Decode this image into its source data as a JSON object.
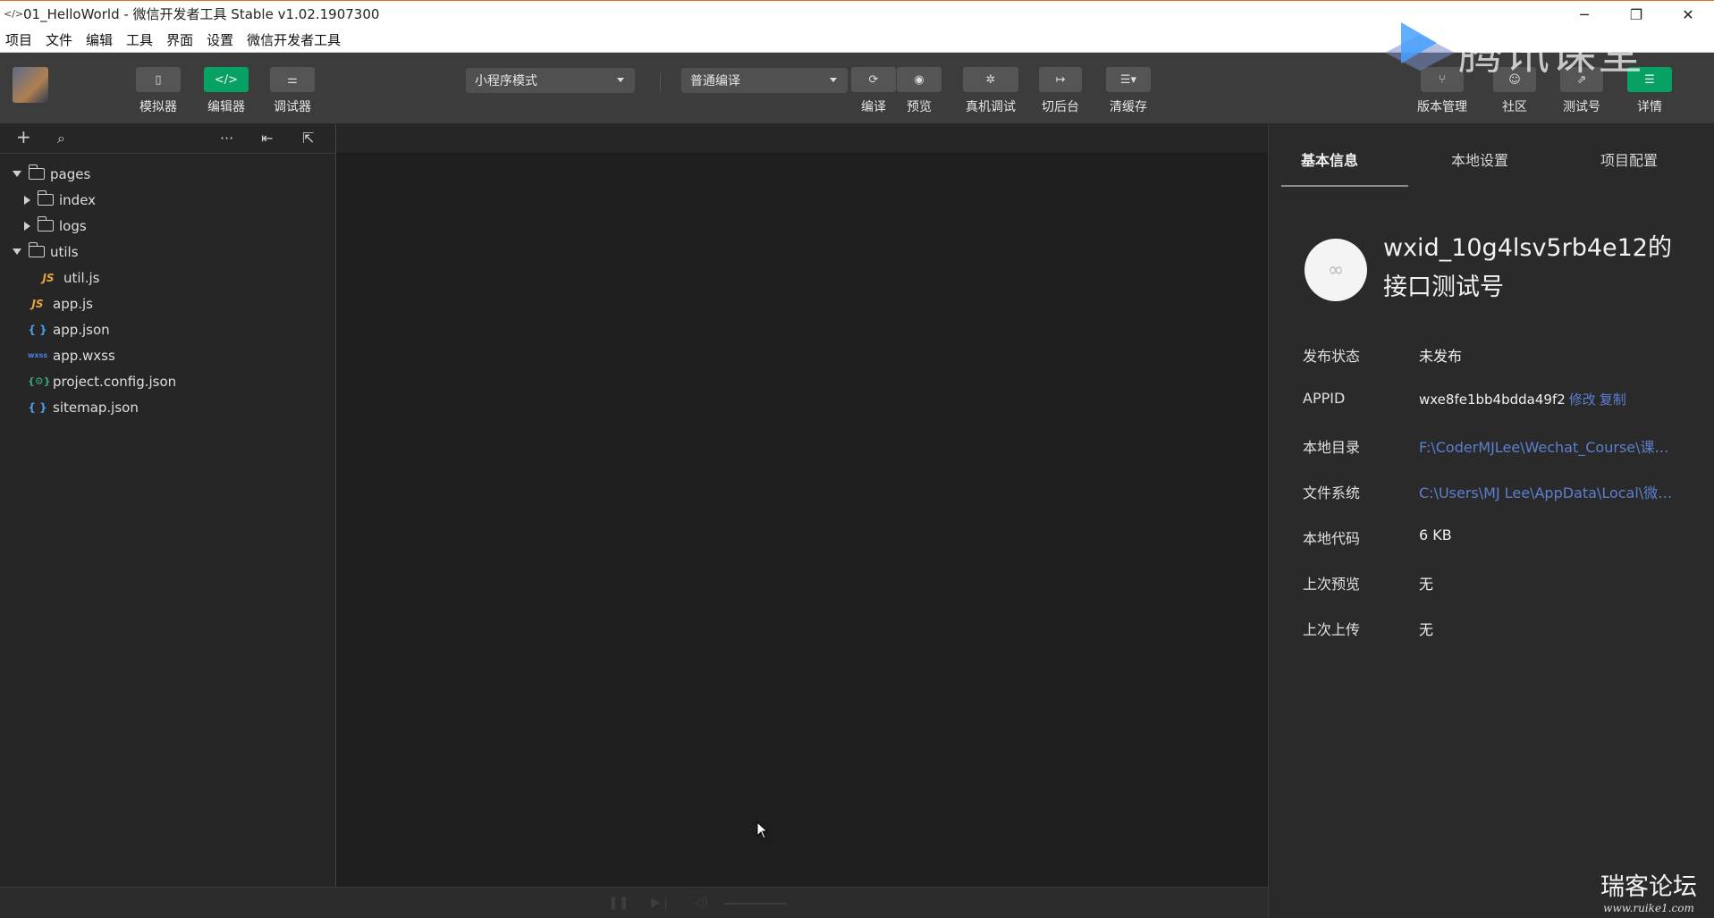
{
  "window": {
    "title": "01_HelloWorld - 微信开发者工具 Stable v1.02.1907300",
    "controls": [
      "minimize-icon",
      "restore-icon",
      "close-icon"
    ]
  },
  "menu": [
    "项目",
    "文件",
    "编辑",
    "工具",
    "界面",
    "设置",
    "微信开发者工具"
  ],
  "toolbar": {
    "simulator": "模拟器",
    "editor": "编辑器",
    "debugger": "调试器",
    "mode_select": "小程序模式",
    "compile_select": "普通编译",
    "compile": "编译",
    "preview": "预览",
    "remote_debug": "真机调试",
    "background": "切后台",
    "clear_cache": "清缓存",
    "version": "版本管理",
    "community": "社区",
    "test_account": "测试号",
    "details": "详情"
  },
  "tree": {
    "pages": "pages",
    "index": "index",
    "logs": "logs",
    "utils": "utils",
    "util_js": "util.js",
    "app_js": "app.js",
    "app_json": "app.json",
    "app_wxss": "app.wxss",
    "project_config": "project.config.json",
    "sitemap": "sitemap.json"
  },
  "detail": {
    "tabs": [
      "基本信息",
      "本地设置",
      "项目配置"
    ],
    "project_name": "wxid_10g4lsv5rb4e12的接口测试号",
    "rows": [
      {
        "label": "发布状态",
        "value": "未发布"
      },
      {
        "label": "APPID",
        "value": "wxe8fe1bb4bdda49f2",
        "edit": "修改",
        "copy": "复制"
      },
      {
        "label": "本地目录",
        "value": "F:\\CoderMJLee\\Wechat_Course\\课堂..."
      },
      {
        "label": "文件系统",
        "value": "C:\\Users\\MJ Lee\\AppData\\Local\\微信..."
      },
      {
        "label": "本地代码",
        "value": "6 KB"
      },
      {
        "label": "上次预览",
        "value": "无"
      },
      {
        "label": "上次上传",
        "value": "无"
      }
    ]
  },
  "watermarks": {
    "brand": "腾讯课堂",
    "forum": "瑞客论坛",
    "forum_url": "www.ruike1.com"
  },
  "colors": {
    "accent_green": "#07a163",
    "link_blue": "#5c7fd0",
    "toolbar_bg": "#3c3c3c"
  }
}
